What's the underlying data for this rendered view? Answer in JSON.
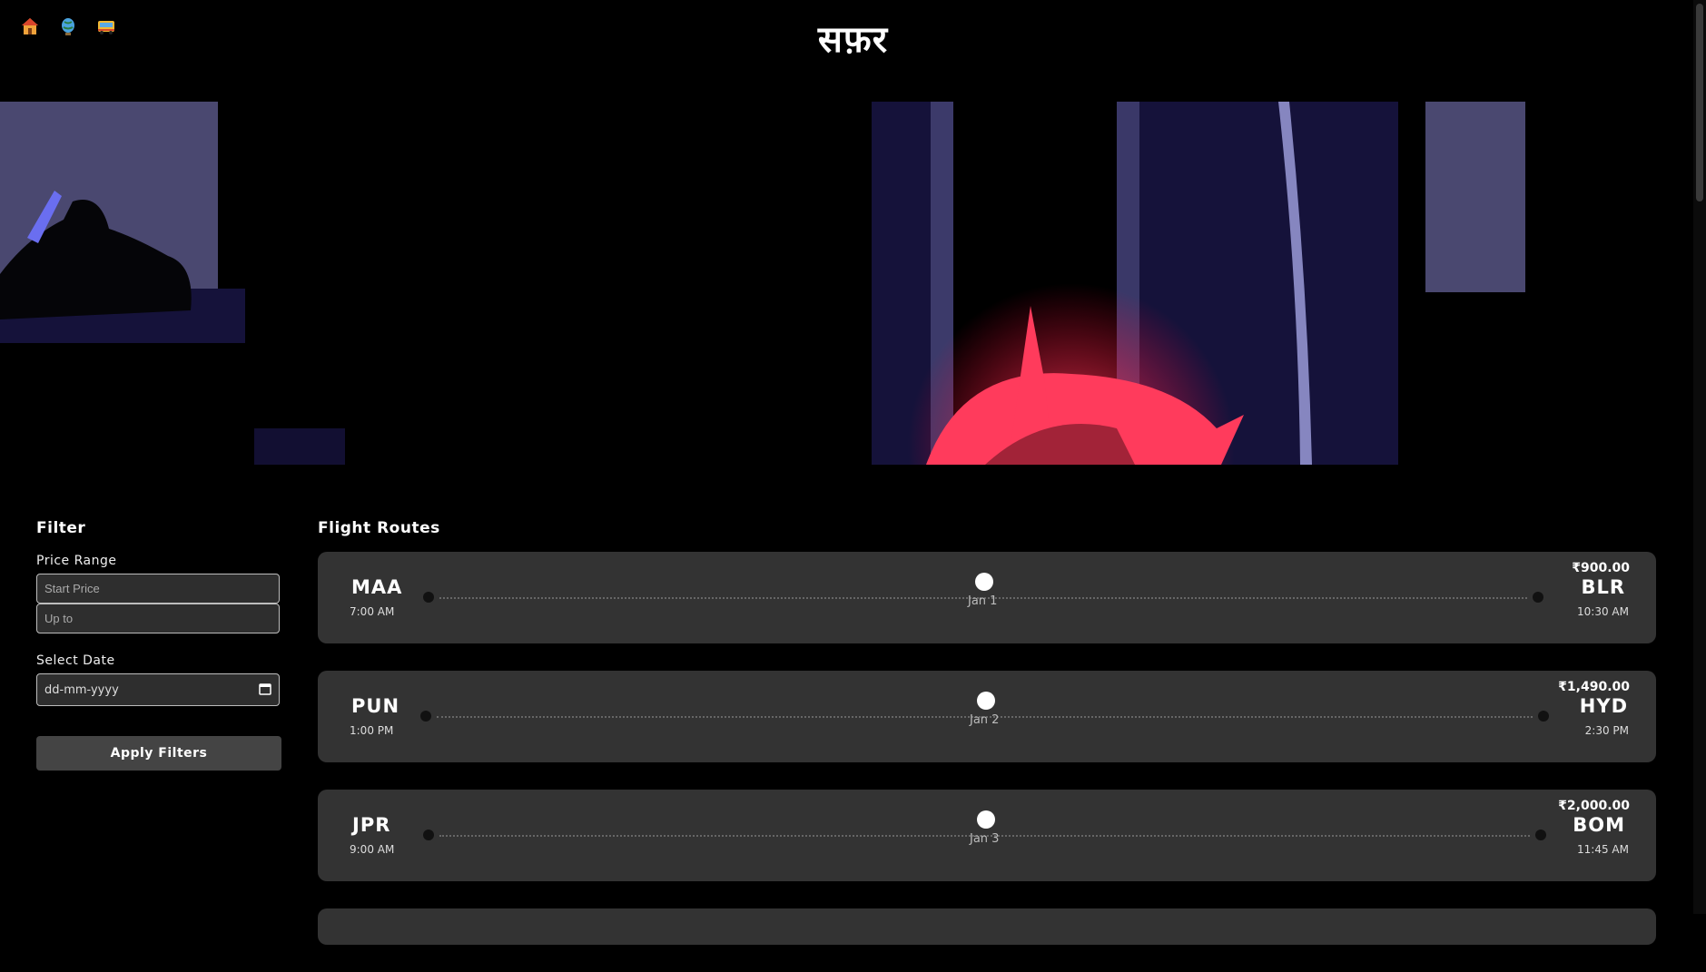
{
  "brand": "सफ़र",
  "nav": {
    "icons": [
      "home-icon",
      "globe-icon",
      "bus-icon"
    ]
  },
  "filter": {
    "title": "Filter",
    "price_range_label": "Price Range",
    "start_placeholder": "Start Price",
    "upto_placeholder": "Up to",
    "date_label": "Select Date",
    "date_placeholder": "dd-mm-yyyy",
    "apply_label": "Apply Filters"
  },
  "routes": {
    "title": "Flight Routes",
    "items": [
      {
        "from": "MAA",
        "dep": "7:00 AM",
        "date": "Jan 1",
        "to": "BLR",
        "arr": "10:30 AM",
        "price": "₹900.00"
      },
      {
        "from": "PUN",
        "dep": "1:00 PM",
        "date": "Jan 2",
        "to": "HYD",
        "arr": "2:30 PM",
        "price": "₹1,490.00"
      },
      {
        "from": "JPR",
        "dep": "9:00 AM",
        "date": "Jan 3",
        "to": "BOM",
        "arr": "11:45 AM",
        "price": "₹2,000.00"
      }
    ]
  },
  "colors": {
    "bg": "#000000",
    "card": "#333333",
    "accent_red": "#ff3b5c",
    "purple": "#5a55a8"
  }
}
